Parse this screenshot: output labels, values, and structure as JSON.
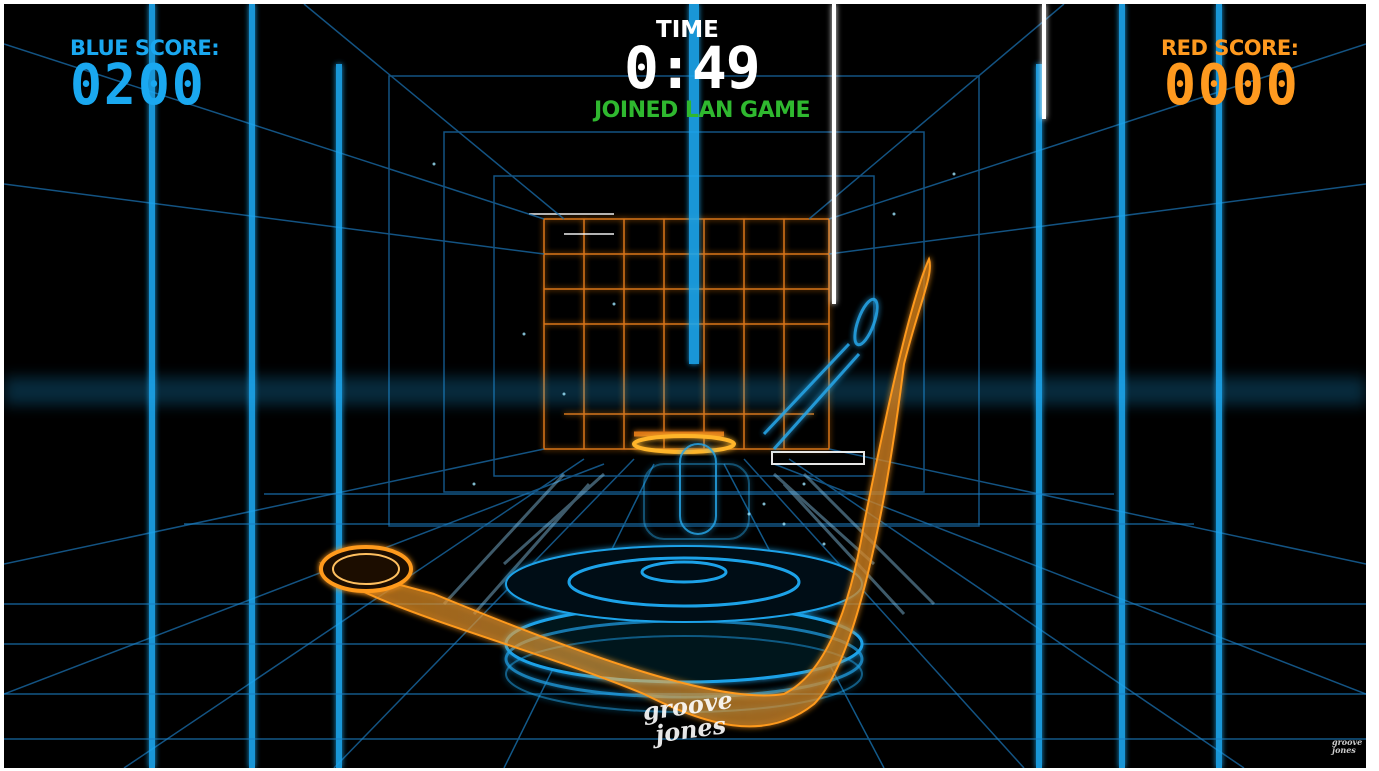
{
  "colors": {
    "blue": "#1aa8f0",
    "orange": "#ff9a1f",
    "green": "#2fb82f",
    "background": "#000000"
  },
  "hud": {
    "blue_label": "BLUE SCORE:",
    "blue_score": "0200",
    "red_label": "RED SCORE:",
    "red_score": "0000",
    "time_label": "TIME",
    "time_value": "0:49",
    "status": "JOINED LAN GAME"
  },
  "watermark": {
    "logo": "groove jones"
  }
}
